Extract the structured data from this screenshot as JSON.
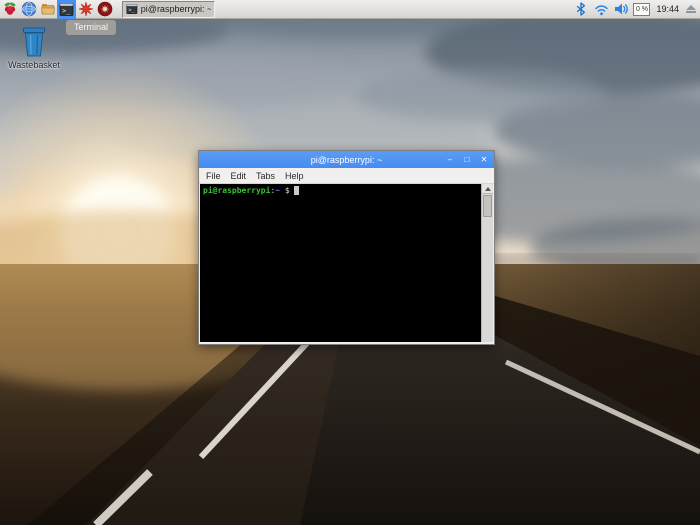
{
  "taskbar": {
    "launchers": [
      {
        "name": "menu",
        "icon": "raspberry-icon"
      },
      {
        "name": "browser",
        "icon": "globe-icon"
      },
      {
        "name": "file-manager",
        "icon": "folder-icon"
      },
      {
        "name": "terminal",
        "icon": "terminal-icon",
        "active": true
      },
      {
        "name": "mathematica",
        "icon": "spikey-icon"
      },
      {
        "name": "wolfram",
        "icon": "wolfram-icon"
      }
    ],
    "window_list": {
      "title": "pi@raspberrypi: ~",
      "icon": "terminal-icon",
      "state": "active"
    },
    "tray": {
      "icons": [
        "bluetooth-icon",
        "wifi-icon",
        "volume-icon"
      ],
      "cpu_monitor": "0 %",
      "clock": "19:44",
      "eject": "eject-icon"
    }
  },
  "tooltip": {
    "text": "Terminal"
  },
  "desktop": {
    "wastebasket_label": "Wastebasket"
  },
  "terminal_window": {
    "title": "pi@raspberrypi: ~",
    "controls": {
      "minimize": "–",
      "maximize": "□",
      "close": "✕"
    },
    "menu_items": [
      "File",
      "Edit",
      "Tabs",
      "Help"
    ],
    "prompt": {
      "user_host": "pi@raspberrypi",
      "separator": ":",
      "path": "~",
      "symbol": " $"
    }
  },
  "colors": {
    "titlebar_blue": "#4a90f2",
    "taskbar_bg": "#dcd9d5",
    "tooltip_bg": "#a29f9b",
    "prompt_green": "#35c335",
    "prompt_blue": "#6f6ff0",
    "terminal_bg": "#000000",
    "wastebasket_blue": "#2f86c7",
    "sunset_glow": "#f6ddb4"
  }
}
